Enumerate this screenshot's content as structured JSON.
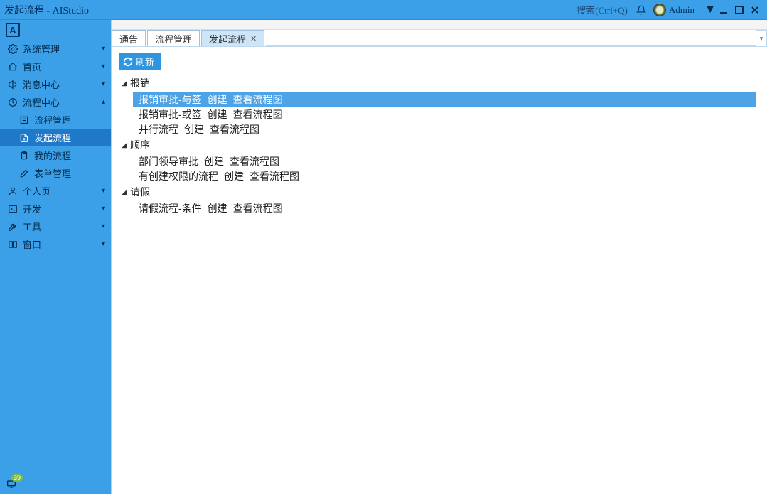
{
  "window": {
    "title": "发起流程 - AIStudio"
  },
  "titlebar": {
    "search_hint": "搜索(Ctrl+Q)",
    "user": "Admin"
  },
  "sidebar": {
    "items": [
      {
        "icon": "gear",
        "label": "系统管理",
        "expandable": true
      },
      {
        "icon": "home",
        "label": "首页",
        "expandable": true
      },
      {
        "icon": "megaphone",
        "label": "消息中心",
        "expandable": true
      },
      {
        "icon": "clock",
        "label": "流程中心",
        "expandable": true,
        "expanded": true
      },
      {
        "icon": "list",
        "label": "流程管理",
        "sub": true
      },
      {
        "icon": "file-plus",
        "label": "发起流程",
        "sub": true,
        "active": true
      },
      {
        "icon": "clipboard",
        "label": "我的流程",
        "sub": true
      },
      {
        "icon": "edit",
        "label": "表单管理",
        "sub": true
      },
      {
        "icon": "user",
        "label": "个人页",
        "expandable": true
      },
      {
        "icon": "terminal",
        "label": "开发",
        "expandable": true
      },
      {
        "icon": "wrench",
        "label": "工具",
        "expandable": true
      },
      {
        "icon": "window",
        "label": "窗口",
        "expandable": true
      }
    ]
  },
  "status": {
    "count": "39"
  },
  "tabs": [
    {
      "label": "通告",
      "active": false,
      "closable": false
    },
    {
      "label": "流程管理",
      "active": false,
      "closable": false
    },
    {
      "label": "发起流程",
      "active": true,
      "closable": true
    }
  ],
  "toolbar": {
    "refresh": "刷新"
  },
  "tree": {
    "groups": [
      {
        "label": "报销",
        "items": [
          {
            "name": "报销审批-与签",
            "create": "创建",
            "view": "查看流程图",
            "selected": true
          },
          {
            "name": "报销审批-或签",
            "create": "创建",
            "view": "查看流程图"
          },
          {
            "name": "并行流程",
            "create": "创建",
            "view": "查看流程图"
          }
        ]
      },
      {
        "label": "顺序",
        "items": [
          {
            "name": "部门领导审批",
            "create": "创建",
            "view": "查看流程图"
          },
          {
            "name": "有创建权限的流程",
            "create": "创建",
            "view": "查看流程图"
          }
        ]
      },
      {
        "label": "请假",
        "items": [
          {
            "name": "请假流程-条件",
            "create": "创建",
            "view": "查看流程图"
          }
        ]
      }
    ]
  }
}
